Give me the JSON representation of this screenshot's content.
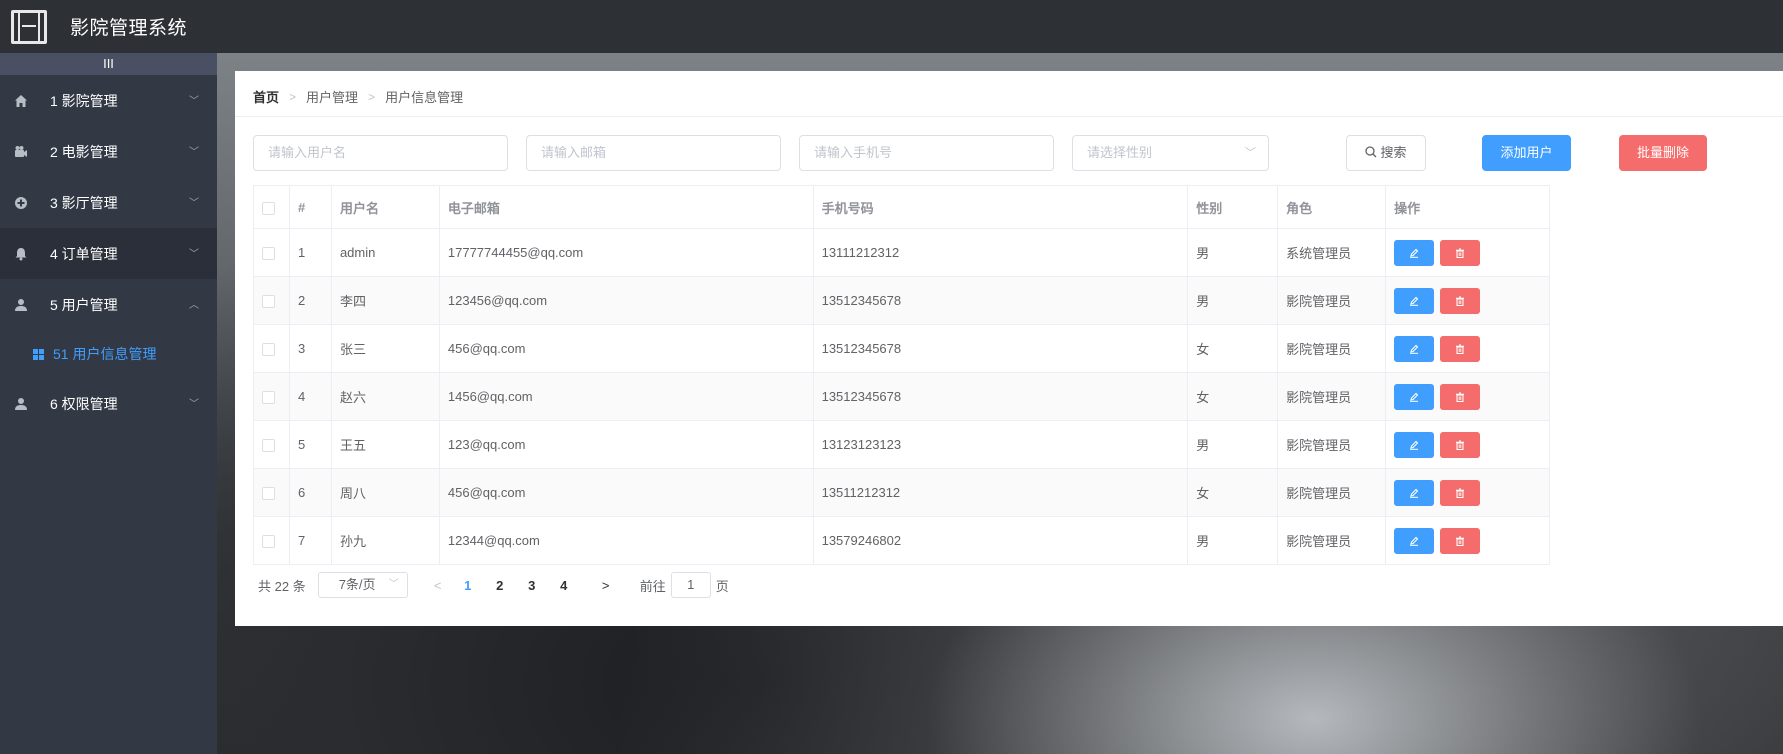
{
  "header": {
    "title": "影院管理系统",
    "logo_icon": "film-icon"
  },
  "sidebar": {
    "collapse_label": "III",
    "items": [
      {
        "label": "1 影院管理",
        "icon": "home-icon"
      },
      {
        "label": "2 电影管理",
        "icon": "camera-icon"
      },
      {
        "label": "3 影厅管理",
        "icon": "plus-circle-icon"
      },
      {
        "label": "4 订单管理",
        "icon": "bell-icon"
      },
      {
        "label": "5 用户管理",
        "icon": "user-icon",
        "expanded": true
      },
      {
        "label": "6 权限管理",
        "icon": "user-icon"
      }
    ],
    "sub_item": {
      "label": "51 用户信息管理",
      "icon": "grid-icon"
    },
    "accent": "#409eff"
  },
  "breadcrumb": [
    "首页",
    "用户管理",
    "用户信息管理"
  ],
  "search": {
    "username_placeholder": "请输入用户名",
    "email_placeholder": "请输入邮箱",
    "phone_placeholder": "请输入手机号",
    "gender_placeholder": "请选择性别",
    "search_label": "搜索",
    "add_label": "添加用户",
    "batch_delete_label": "批量删除"
  },
  "table": {
    "headers": [
      "#",
      "用户名",
      "电子邮箱",
      "手机号码",
      "性别",
      "角色",
      "操作"
    ],
    "rows": [
      {
        "id": "1",
        "username": "admin",
        "email": "17777744455@qq.com",
        "phone": "13111212312",
        "gender": "男",
        "role": "系统管理员"
      },
      {
        "id": "2",
        "username": "李四",
        "email": "123456@qq.com",
        "phone": "13512345678",
        "gender": "男",
        "role": "影院管理员"
      },
      {
        "id": "3",
        "username": "张三",
        "email": "456@qq.com",
        "phone": "13512345678",
        "gender": "女",
        "role": "影院管理员"
      },
      {
        "id": "4",
        "username": "赵六",
        "email": "1456@qq.com",
        "phone": "13512345678",
        "gender": "女",
        "role": "影院管理员"
      },
      {
        "id": "5",
        "username": "王五",
        "email": "123@qq.com",
        "phone": "13123123123",
        "gender": "男",
        "role": "影院管理员"
      },
      {
        "id": "6",
        "username": "周八",
        "email": "456@qq.com",
        "phone": "13511212312",
        "gender": "女",
        "role": "影院管理员"
      },
      {
        "id": "7",
        "username": "孙九",
        "email": "12344@qq.com",
        "phone": "13579246802",
        "gender": "男",
        "role": "影院管理员"
      }
    ]
  },
  "pagination": {
    "total_label": "共 22 条",
    "page_size_label": "7条/页",
    "pages": [
      "1",
      "2",
      "3",
      "4"
    ],
    "current_page": "1",
    "goto_prefix": "前往",
    "goto_value": "1",
    "goto_suffix": "页"
  }
}
